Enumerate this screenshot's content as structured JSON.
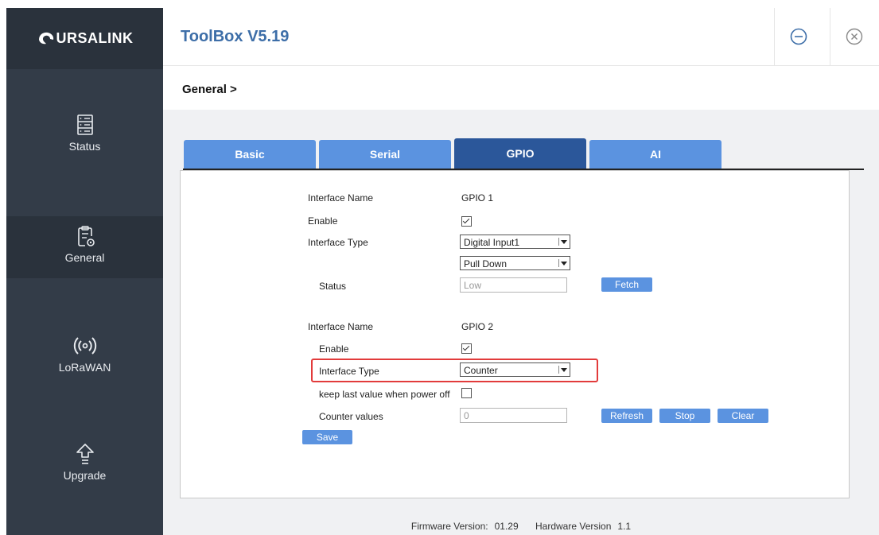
{
  "brand": {
    "name": "URSALINK"
  },
  "app": {
    "title": "ToolBox V5.19"
  },
  "window": {
    "minimize_icon": "minus-circle-icon",
    "close_icon": "x-circle-icon"
  },
  "sidebar": {
    "items": [
      {
        "label": "Status",
        "icon": "server-icon"
      },
      {
        "label": "General",
        "icon": "clipboard-gear-icon"
      },
      {
        "label": "LoRaWAN",
        "icon": "wireless-icon"
      },
      {
        "label": "Upgrade",
        "icon": "upload-arrow-icon"
      }
    ]
  },
  "breadcrumb": "General >",
  "tabs": [
    {
      "label": "Basic"
    },
    {
      "label": "Serial"
    },
    {
      "label": "GPIO"
    },
    {
      "label": "AI"
    }
  ],
  "gpio1": {
    "interface_name_label": "Interface Name",
    "interface_name_value": "GPIO 1",
    "enable_label": "Enable",
    "enable_checked": true,
    "interface_type_label": "Interface Type",
    "interface_type_value": "Digital Input1",
    "pull_value": "Pull Down",
    "status_label": "Status",
    "status_value": "Low",
    "fetch_label": "Fetch"
  },
  "gpio2": {
    "interface_name_label": "Interface Name",
    "interface_name_value": "GPIO 2",
    "enable_label": "Enable",
    "enable_checked": true,
    "interface_type_label": "Interface Type",
    "interface_type_value": "Counter",
    "keep_last_label": "keep last value when power off",
    "keep_last_checked": false,
    "counter_label": "Counter values",
    "counter_value": "0",
    "refresh_label": "Refresh",
    "stop_label": "Stop",
    "clear_label": "Clear"
  },
  "save_label": "Save",
  "footer": {
    "firmware_label": "Firmware Version:",
    "firmware_value": "01.29",
    "hardware_label": "Hardware Version",
    "hardware_value": "1.1"
  },
  "colors": {
    "accent": "#5b93e0",
    "active_tab": "#2b579a",
    "sidebar": "#333c48",
    "title": "#3d6ea8",
    "highlight": "#e23b3b"
  }
}
